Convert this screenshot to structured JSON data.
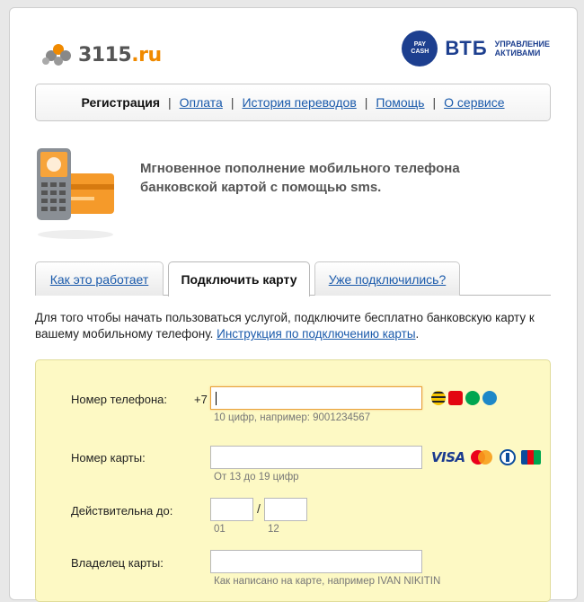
{
  "header": {
    "logo_text": "3115",
    "logo_domain": ".ru",
    "partner_logo_badge": "PAY CASH",
    "partner_name": "ВТБ",
    "partner_sub_line1": "УПРАВЛЕНИЕ",
    "partner_sub_line2": "АКТИВАМИ"
  },
  "nav": {
    "items": [
      {
        "label": "Регистрация",
        "active": true
      },
      {
        "label": "Оплата"
      },
      {
        "label": "История переводов"
      },
      {
        "label": "Помощь"
      },
      {
        "label": "О сервисе"
      }
    ],
    "separator": "|"
  },
  "promo": {
    "text": "Мгновенное пополнение мобильного телефона банковской картой с помощью sms."
  },
  "tabs": [
    {
      "label": "Как это работает"
    },
    {
      "label": "Подключить карту",
      "active": true
    },
    {
      "label": "Уже подключились?"
    }
  ],
  "description": {
    "text": "Для того чтобы начать пользоваться услугой, подключите бесплатно банковскую карту к вашему мобильному телефону. ",
    "link": "Инструкция по подключению карты",
    "end": "."
  },
  "form": {
    "phone": {
      "label": "Номер телефона:",
      "prefix": "+7",
      "value": "",
      "hint": "10 цифр, например: 9001234567"
    },
    "card": {
      "label": "Номер карты:",
      "value": "",
      "hint": "От 13 до 19 цифр"
    },
    "expiry": {
      "label": "Действительна до:",
      "month_hint": "01",
      "year_hint": "12",
      "separator": "/"
    },
    "holder": {
      "label": "Владелец карты:",
      "value": "",
      "hint": "Как написано на карте, например IVAN NIKITIN"
    }
  },
  "icons": {
    "operators": [
      "beeline-icon",
      "mts-icon",
      "megafon-icon",
      "tele2-icon"
    ],
    "card_brands": [
      "visa-logo",
      "mastercard-logo",
      "diners-logo",
      "jcb-logo"
    ],
    "card_brand_visa_text": "VISA",
    "card_brand_jcb_text": "JCB"
  },
  "colors": {
    "link": "#1a5aab",
    "form_bg": "#fdf9c4",
    "brand_orange": "#f08a00",
    "vtb_blue": "#1d3f8f"
  }
}
